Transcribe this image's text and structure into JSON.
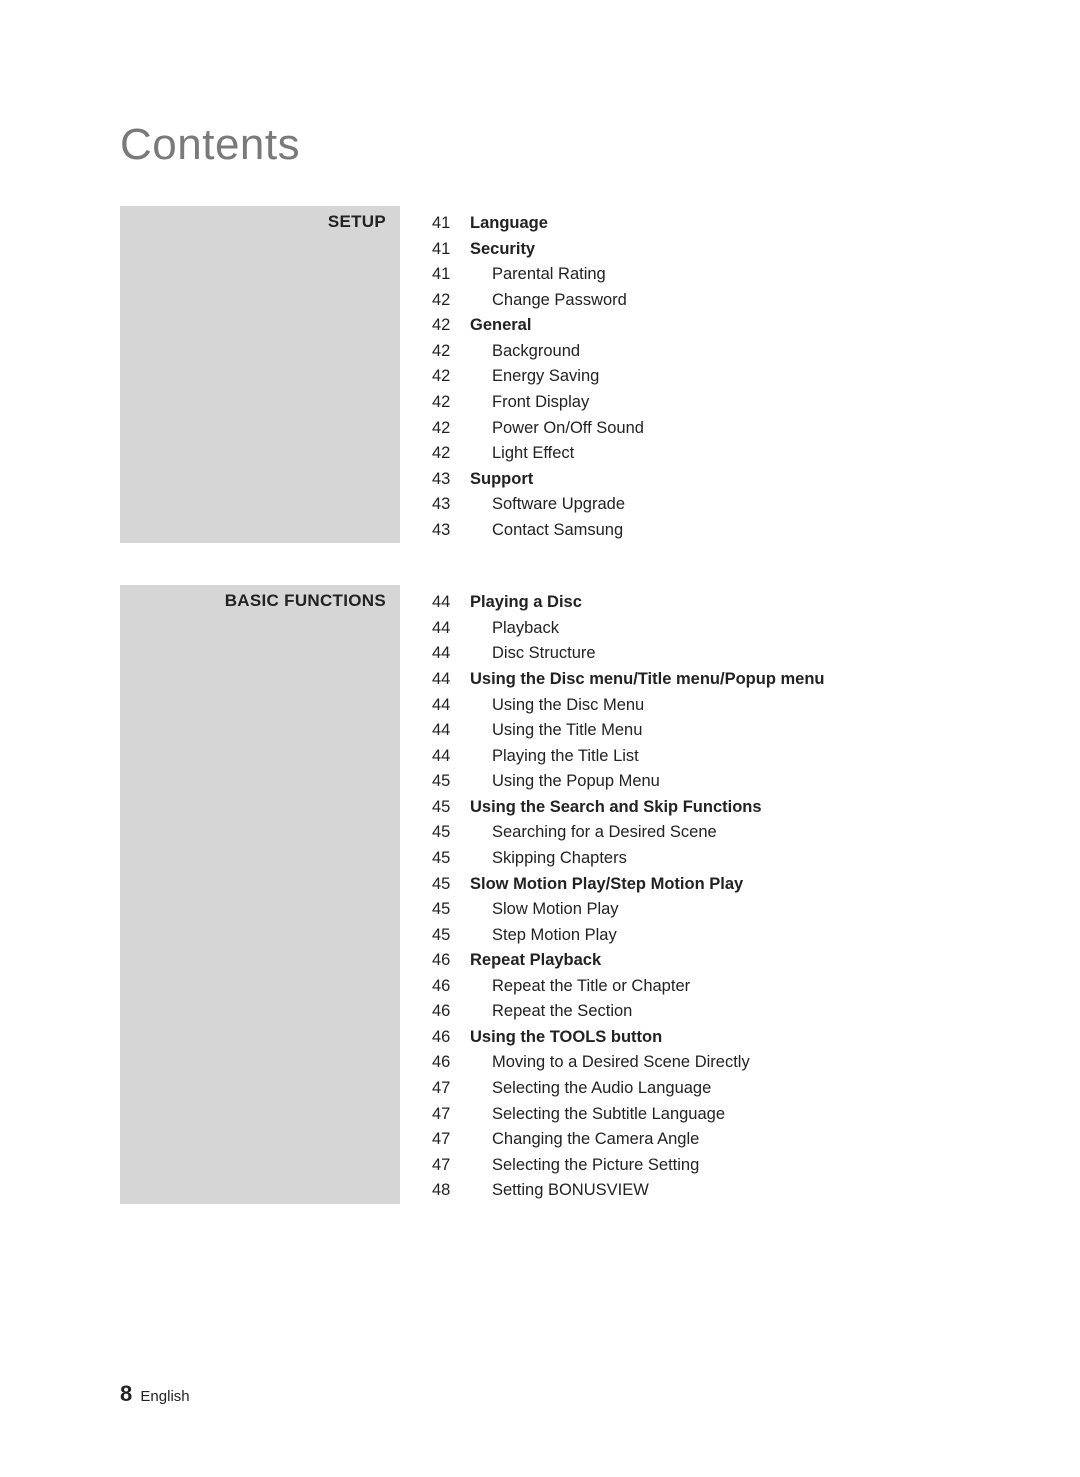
{
  "heading": "Contents",
  "sections": [
    {
      "label": "SETUP",
      "entries": [
        {
          "page": "41",
          "label": "Language",
          "bold": true,
          "indent": 0
        },
        {
          "page": "41",
          "label": "Security",
          "bold": true,
          "indent": 0
        },
        {
          "page": "41",
          "label": "Parental Rating",
          "bold": false,
          "indent": 1
        },
        {
          "page": "42",
          "label": "Change Password",
          "bold": false,
          "indent": 1
        },
        {
          "page": "42",
          "label": "General",
          "bold": true,
          "indent": 0
        },
        {
          "page": "42",
          "label": "Background",
          "bold": false,
          "indent": 1
        },
        {
          "page": "42",
          "label": "Energy Saving",
          "bold": false,
          "indent": 1
        },
        {
          "page": "42",
          "label": "Front Display",
          "bold": false,
          "indent": 1
        },
        {
          "page": "42",
          "label": "Power On/Off Sound",
          "bold": false,
          "indent": 1
        },
        {
          "page": "42",
          "label": "Light Effect",
          "bold": false,
          "indent": 1
        },
        {
          "page": "43",
          "label": "Support",
          "bold": true,
          "indent": 0
        },
        {
          "page": "43",
          "label": "Software Upgrade",
          "bold": false,
          "indent": 1
        },
        {
          "page": "43",
          "label": "Contact Samsung",
          "bold": false,
          "indent": 1
        }
      ]
    },
    {
      "label": "BASIC FUNCTIONS",
      "entries": [
        {
          "page": "44",
          "label": "Playing a Disc",
          "bold": true,
          "indent": 0
        },
        {
          "page": "44",
          "label": "Playback",
          "bold": false,
          "indent": 1
        },
        {
          "page": "44",
          "label": "Disc Structure",
          "bold": false,
          "indent": 1
        },
        {
          "page": "44",
          "label": "Using the Disc menu/Title menu/Popup menu",
          "bold": true,
          "indent": 0
        },
        {
          "page": "44",
          "label": "Using the Disc Menu",
          "bold": false,
          "indent": 1
        },
        {
          "page": "44",
          "label": "Using the Title Menu",
          "bold": false,
          "indent": 1
        },
        {
          "page": "44",
          "label": "Playing the Title List",
          "bold": false,
          "indent": 1
        },
        {
          "page": "45",
          "label": "Using the Popup Menu",
          "bold": false,
          "indent": 1
        },
        {
          "page": "45",
          "label": "Using the Search and Skip Functions",
          "bold": true,
          "indent": 0
        },
        {
          "page": "45",
          "label": "Searching for a Desired Scene",
          "bold": false,
          "indent": 1
        },
        {
          "page": "45",
          "label": "Skipping Chapters",
          "bold": false,
          "indent": 1
        },
        {
          "page": "45",
          "label": "Slow Motion Play/Step Motion Play",
          "bold": true,
          "indent": 0
        },
        {
          "page": "45",
          "label": "Slow Motion Play",
          "bold": false,
          "indent": 1
        },
        {
          "page": "45",
          "label": "Step Motion Play",
          "bold": false,
          "indent": 1
        },
        {
          "page": "46",
          "label": "Repeat Playback",
          "bold": true,
          "indent": 0
        },
        {
          "page": "46",
          "label": "Repeat the Title or Chapter",
          "bold": false,
          "indent": 1
        },
        {
          "page": "46",
          "label": "Repeat the Section",
          "bold": false,
          "indent": 1
        },
        {
          "page": "46",
          "label": "Using the TOOLS button",
          "bold": true,
          "indent": 0
        },
        {
          "page": "46",
          "label": "Moving to a Desired Scene Directly",
          "bold": false,
          "indent": 1
        },
        {
          "page": "47",
          "label": "Selecting the Audio Language",
          "bold": false,
          "indent": 1
        },
        {
          "page": "47",
          "label": "Selecting the Subtitle Language",
          "bold": false,
          "indent": 1
        },
        {
          "page": "47",
          "label": "Changing the Camera Angle",
          "bold": false,
          "indent": 1
        },
        {
          "page": "47",
          "label": "Selecting the Picture Setting",
          "bold": false,
          "indent": 1
        },
        {
          "page": "48",
          "label": "Setting BONUSVIEW",
          "bold": false,
          "indent": 1
        }
      ]
    }
  ],
  "footer": {
    "page_number": "8",
    "language": "English"
  }
}
